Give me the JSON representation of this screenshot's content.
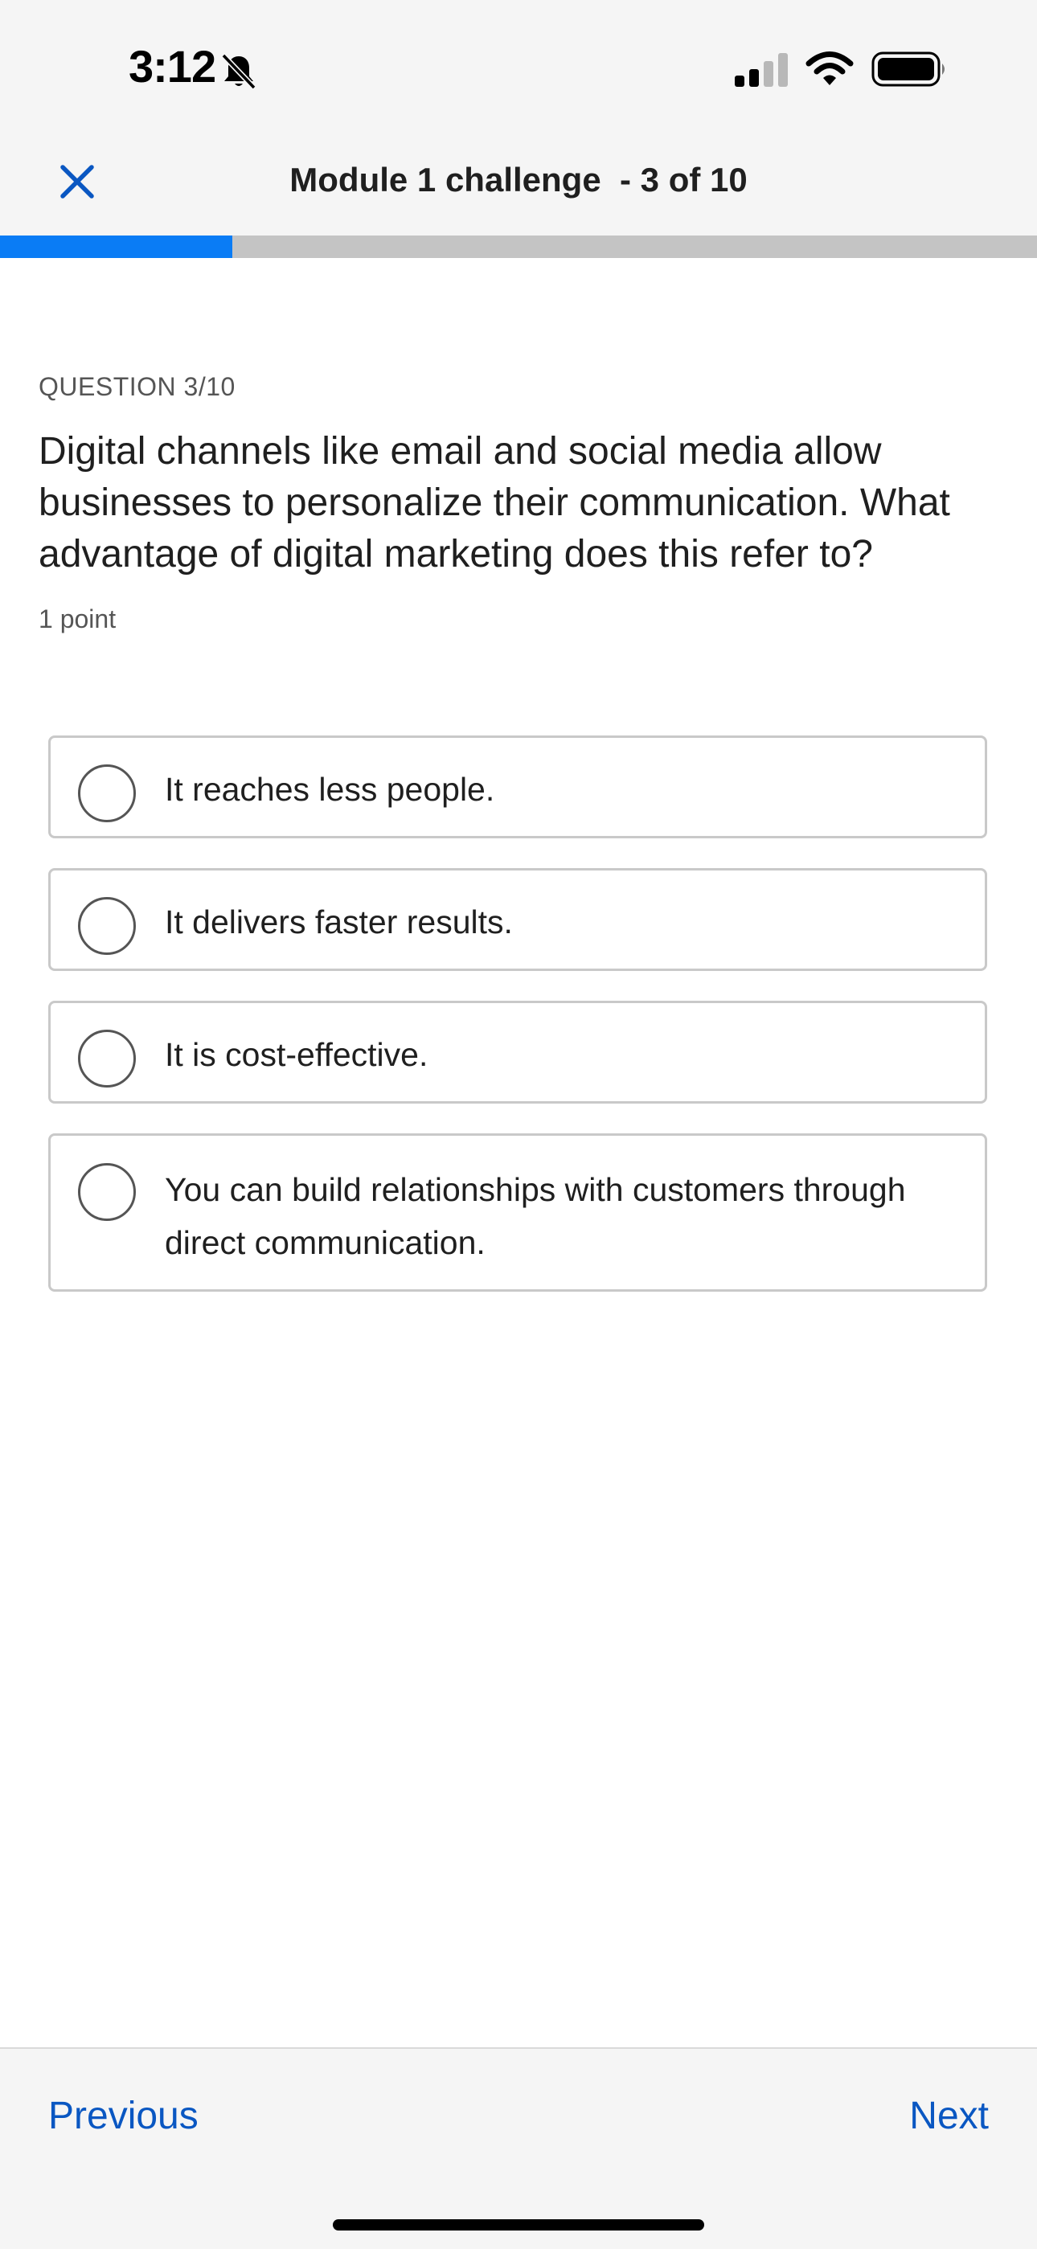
{
  "status_bar": {
    "time": "3:12",
    "icons": [
      "bell-slash-icon",
      "cellular-signal-icon",
      "wifi-icon",
      "battery-icon"
    ]
  },
  "header": {
    "close_icon": "close-icon",
    "title": "Module 1 challenge  - 3 of 10"
  },
  "progress": {
    "current": 3,
    "total": 10,
    "fraction": 0.2,
    "fill_color": "#0a7cf5",
    "track_color": "#c4c4c4"
  },
  "question": {
    "label": "QUESTION 3/10",
    "text": "Digital channels like email and social media allow businesses to personalize their communication. What advantage of digital marketing does this refer to?",
    "points": "1 point"
  },
  "options": [
    {
      "label": "It reaches less people.",
      "selected": false
    },
    {
      "label": "It delivers faster results.",
      "selected": false
    },
    {
      "label": "It is cost-effective.",
      "selected": false
    },
    {
      "label": "You can build relationships with customers through direct communication.",
      "selected": false
    }
  ],
  "footer": {
    "previous_label": "Previous",
    "next_label": "Next",
    "link_color": "#0a57c2"
  }
}
